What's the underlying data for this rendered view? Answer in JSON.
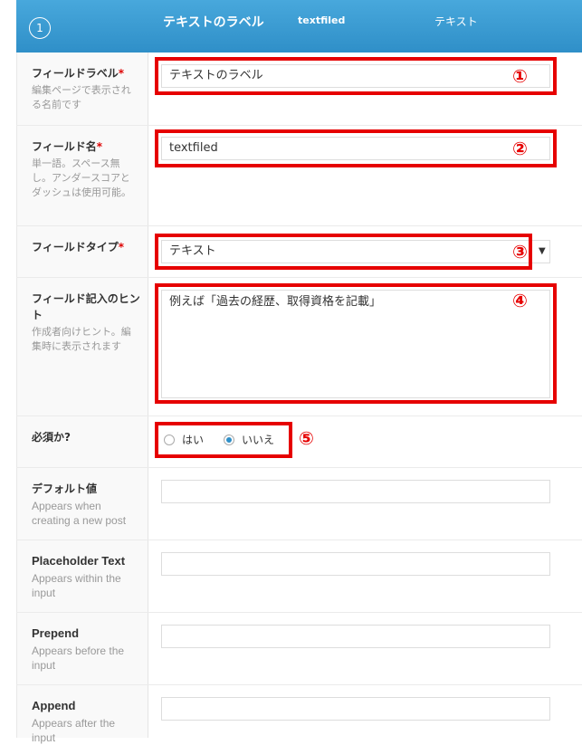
{
  "header": {
    "number": "1",
    "label": "テキストのラベル",
    "name": "textfiled",
    "type": "テキスト"
  },
  "fields": {
    "label": {
      "title": "フィールドラベル",
      "required": "*",
      "desc": "編集ページで表示される名前です",
      "value": "テキストのラベル",
      "marker": "①"
    },
    "name": {
      "title": "フィールド名",
      "required": "*",
      "desc": "単一語。スペース無し。アンダースコアとダッシュは使用可能。",
      "value": "textfiled",
      "marker": "②"
    },
    "type": {
      "title": "フィールドタイプ",
      "required": "*",
      "value": "テキスト",
      "marker": "③",
      "arrow": "▼"
    },
    "hint": {
      "title": "フィールド記入のヒント",
      "desc": "作成者向けヒント。編集時に表示されます",
      "value": "例えば「過去の経歴、取得資格を記載」",
      "marker": "④"
    },
    "required": {
      "title": "必須か?",
      "yes": "はい",
      "no": "いいえ",
      "selected": "no",
      "marker": "⑤"
    },
    "default": {
      "title": "デフォルト値",
      "desc": "Appears when creating a new post",
      "value": ""
    },
    "placeholder": {
      "title": "Placeholder Text",
      "desc": "Appears within the input",
      "value": ""
    },
    "prepend": {
      "title": "Prepend",
      "desc": "Appears before the input",
      "value": ""
    },
    "append": {
      "title": "Append",
      "desc": "Appears after the input",
      "value": ""
    }
  },
  "colors": {
    "header": "#2f8fc8",
    "highlight": "#e60000",
    "required": "#dd0000"
  }
}
